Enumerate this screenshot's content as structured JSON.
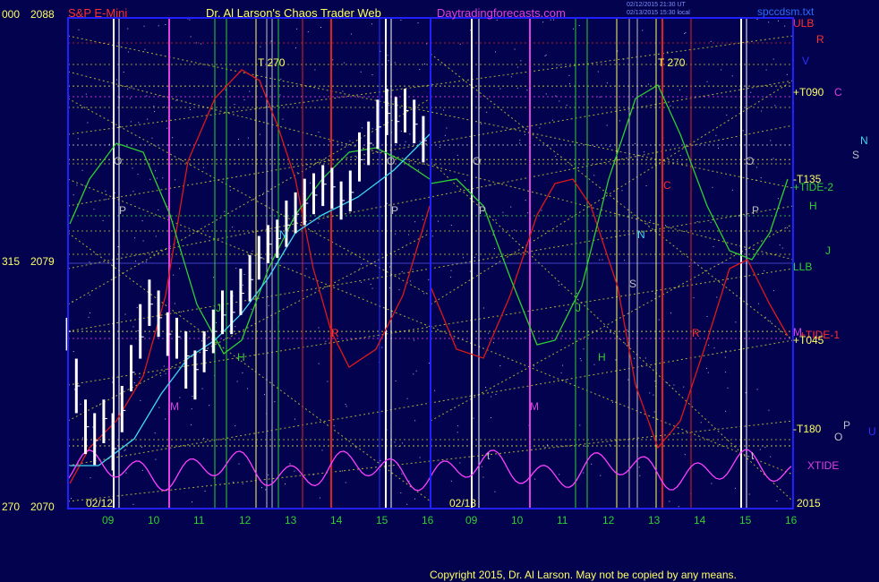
{
  "header": {
    "symbol": "S&P E-Mini",
    "title": "Dr. Al Larson's Chaos Trader Web",
    "site": "Daytradingforecasts.com",
    "stamp_line1": "02/12/2015 21:30 UT",
    "stamp_line2": "02/13/2015 15:30 local",
    "file": "spccdsm.txt"
  },
  "footer": {
    "copyright": "Copyright 2015, Dr. Al Larson. May not be copied by any means."
  },
  "axis": {
    "y_top_left": "000",
    "y_top": "2088",
    "y_mid_left": "315",
    "y_mid": "2079",
    "y_bot_left": "270",
    "y_bot": "2070",
    "date_left": "02/12",
    "date_right": "02/13",
    "year": "2015",
    "x_ticks_day1": [
      "09",
      "10",
      "11",
      "12",
      "13",
      "14",
      "15",
      "16"
    ],
    "x_ticks_day2": [
      "09",
      "10",
      "11",
      "12",
      "13",
      "14",
      "15",
      "16"
    ]
  },
  "right_labels": {
    "ulb": "ULB",
    "r": "R",
    "v": "V",
    "t090": "+T090",
    "c": "C",
    "n": "N",
    "s": "S",
    "t135": "-T135",
    "tide2": "+TIDE-2",
    "h": "H",
    "j": "J",
    "llb": "LLB",
    "tide1": "+TIDE-1",
    "t045": "+T045",
    "m": "M",
    "t180": "-T180",
    "p": "P",
    "o": "O",
    "u": "U",
    "xtide": "XTIDE"
  },
  "plot_markers": {
    "t270_a": "T  270",
    "t270_b": "T  270",
    "o1": "O",
    "o2": "O",
    "o3": "O",
    "o4": "O",
    "p1": "P",
    "p2": "P",
    "p3": "P",
    "p4": "P",
    "n1": "N",
    "n2": "N",
    "s1": "S",
    "j1": "J",
    "j2": "J",
    "h1": "H",
    "h2": "H",
    "m1": "M",
    "m2": "M",
    "r1": "R",
    "r2": "R",
    "c1": "C",
    "t1": "t",
    "t2": "t"
  },
  "colors": {
    "background": "#02024f",
    "plot_border": "#2020ff",
    "axis_text": "#ffff66",
    "price_bars": "#ffffff",
    "red_line": "#e01818",
    "green_line": "#30d030",
    "cyan_line": "#40d8f0",
    "magenta_line": "#ff40ff",
    "diagonal_lines": "#d8d830",
    "header_symbol": "#ff3030",
    "header_site": "#e040e0"
  },
  "chart_data": {
    "type": "line",
    "title": "S&P E-Mini",
    "ylim": [
      2070,
      2088
    ],
    "y_ticks": [
      2070,
      2079,
      2088
    ],
    "x_categories": [
      "09",
      "10",
      "11",
      "12",
      "13",
      "14",
      "15",
      "16",
      "09",
      "10",
      "11",
      "12",
      "13",
      "14",
      "15",
      "16"
    ],
    "sessions": [
      "02/12",
      "02/13"
    ],
    "price_series": {
      "name": "S&P E-Mini",
      "x_hours": [
        8.1,
        8.3,
        8.5,
        8.7,
        8.9,
        9.1,
        9.3,
        9.5,
        9.7,
        9.9,
        10.1,
        10.3,
        10.5,
        10.7,
        10.9,
        11.1,
        11.3,
        11.5,
        11.7,
        11.9,
        12.1,
        12.3,
        12.5,
        12.7,
        12.9,
        13.1,
        13.3,
        13.5,
        13.7,
        13.9,
        14.1,
        14.3,
        14.5,
        14.7,
        14.9,
        15.1,
        15.3,
        15.5,
        15.7,
        15.9
      ],
      "close": [
        2076.5,
        2074.5,
        2073.0,
        2072.5,
        2073.3,
        2072.2,
        2073.6,
        2075.0,
        2076.3,
        2077.5,
        2077.0,
        2076.4,
        2076.3,
        2075.6,
        2075.1,
        2075.8,
        2076.5,
        2077.1,
        2077.2,
        2077.9,
        2078.4,
        2079.2,
        2079.7,
        2079.9,
        2080.4,
        2080.8,
        2081.2,
        2081.5,
        2081.9,
        2081.8,
        2081.3,
        2081.6,
        2082.8,
        2083.4,
        2084.0,
        2084.5,
        2084.2,
        2084.6,
        2084.1,
        2083.5
      ],
      "high": [
        2077.0,
        2075.5,
        2074.0,
        2073.5,
        2074.0,
        2073.5,
        2074.5,
        2076.0,
        2077.5,
        2078.4,
        2078.0,
        2077.2,
        2077.0,
        2076.5,
        2075.8,
        2076.5,
        2077.3,
        2078.0,
        2078.0,
        2078.8,
        2079.3,
        2080.0,
        2080.4,
        2080.6,
        2081.3,
        2081.6,
        2082.1,
        2082.3,
        2082.6,
        2082.5,
        2082.0,
        2082.4,
        2083.8,
        2084.2,
        2085.0,
        2085.4,
        2085.1,
        2085.4,
        2085.0,
        2084.4
      ],
      "low": [
        2075.8,
        2073.5,
        2072.0,
        2071.6,
        2072.4,
        2071.4,
        2072.8,
        2074.3,
        2075.5,
        2076.7,
        2076.3,
        2075.6,
        2075.5,
        2074.4,
        2074.0,
        2075.0,
        2075.7,
        2076.4,
        2076.4,
        2077.1,
        2077.6,
        2078.4,
        2079.0,
        2079.2,
        2079.6,
        2080.1,
        2080.4,
        2080.8,
        2081.1,
        2081.0,
        2080.6,
        2080.9,
        2082.0,
        2082.6,
        2083.2,
        2083.7,
        2083.4,
        2083.8,
        2083.4,
        2082.7
      ]
    },
    "series": [
      {
        "name": "XTIDE",
        "color": "#ff40ff",
        "note_level": "bottom band"
      },
      {
        "name": "TIDE-1",
        "color": "#e01818"
      },
      {
        "name": "TIDE-2",
        "color": "#30d030"
      }
    ],
    "reference_levels": [
      {
        "label": "+T090",
        "value": 2085.5
      },
      {
        "label": "-T135",
        "value": 2082.8
      },
      {
        "label": "+T045",
        "value": 2076.5
      },
      {
        "label": "-T180",
        "value": 2072.3
      }
    ],
    "grid": true,
    "legend": "right"
  }
}
